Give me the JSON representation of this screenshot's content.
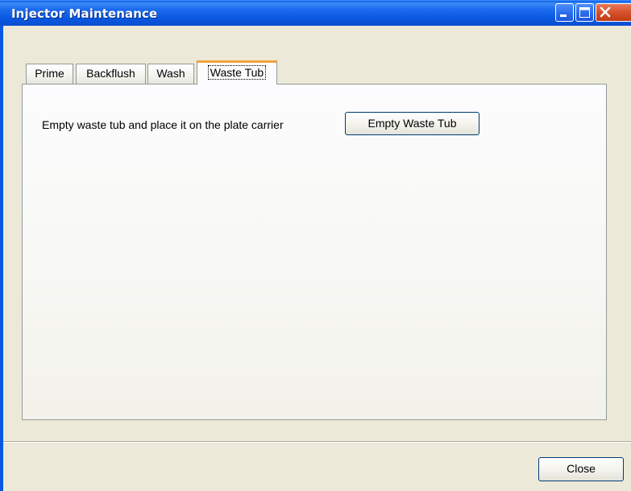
{
  "window": {
    "title": "Injector Maintenance",
    "controls": {
      "minimize": "minimize-icon",
      "maximize": "maximize-icon",
      "close": "close-icon"
    },
    "titlebar_color": "#0a58e0",
    "close_color": "#d4522a"
  },
  "tabs": [
    {
      "label": "Prime",
      "selected": false
    },
    {
      "label": "Backflush",
      "selected": false
    },
    {
      "label": "Wash",
      "selected": false
    },
    {
      "label": "Waste Tub",
      "selected": true
    }
  ],
  "waste_tub": {
    "instruction": "Empty waste tub and place it on the plate carrier",
    "action_label": "Empty Waste Tub"
  },
  "footer": {
    "close_label": "Close"
  }
}
